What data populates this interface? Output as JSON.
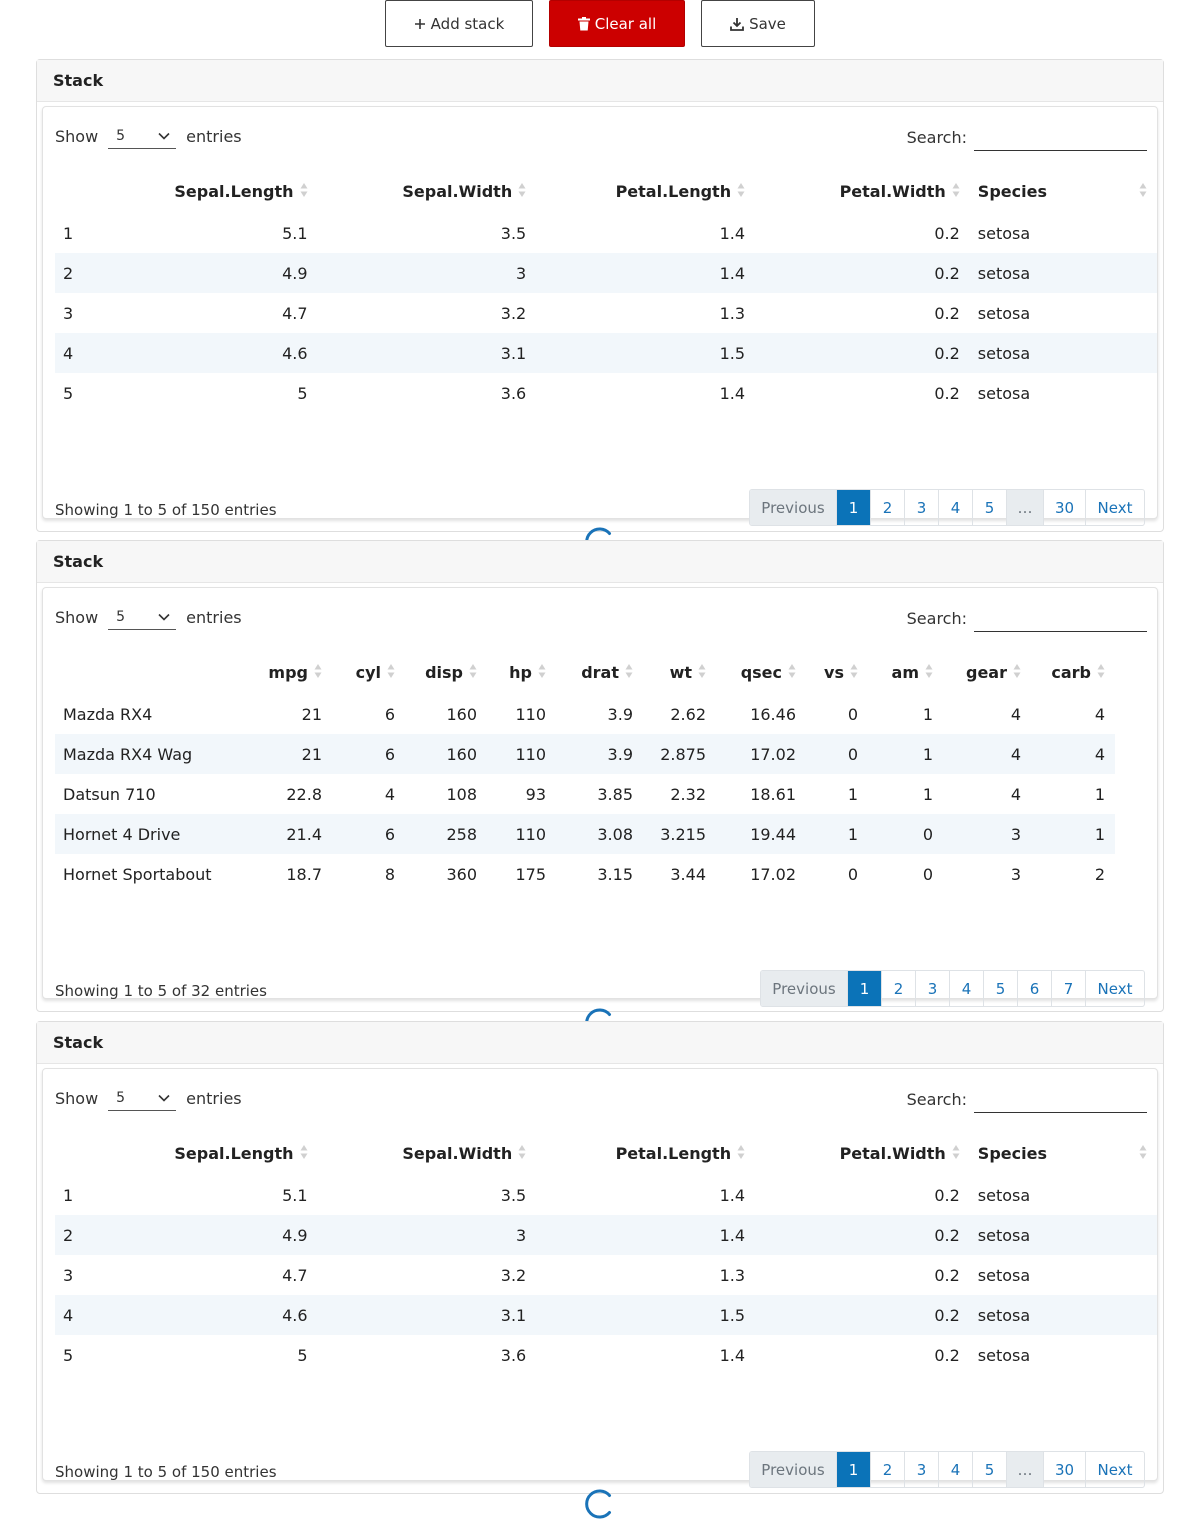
{
  "toolbar": {
    "add_label": "Add stack",
    "clear_label": "Clear all",
    "save_label": "Save",
    "danger_color": "#cc0000"
  },
  "stacks": [
    {
      "title": "Stack",
      "length_prefix": "Show",
      "length_value": "5",
      "length_suffix": "entries",
      "search_label": "Search:",
      "columns": [
        "",
        "Sepal.Length",
        "Sepal.Width",
        "Petal.Length",
        "Petal.Width",
        "Species"
      ],
      "rows": [
        [
          "1",
          "5.1",
          "3.5",
          "1.4",
          "0.2",
          "setosa"
        ],
        [
          "2",
          "4.9",
          "3",
          "1.4",
          "0.2",
          "setosa"
        ],
        [
          "3",
          "4.7",
          "3.2",
          "1.3",
          "0.2",
          "setosa"
        ],
        [
          "4",
          "4.6",
          "3.1",
          "1.5",
          "0.2",
          "setosa"
        ],
        [
          "5",
          "5",
          "3.6",
          "1.4",
          "0.2",
          "setosa"
        ]
      ],
      "info": "Showing 1 to 5 of 150 entries",
      "pagination": [
        "Previous",
        "1",
        "2",
        "3",
        "4",
        "5",
        "…",
        "30",
        "Next"
      ],
      "active_page": "1"
    },
    {
      "title": "Stack",
      "length_prefix": "Show",
      "length_value": "5",
      "length_suffix": "entries",
      "search_label": "Search:",
      "columns": [
        "",
        "mpg",
        "cyl",
        "disp",
        "hp",
        "drat",
        "wt",
        "qsec",
        "vs",
        "am",
        "gear",
        "carb"
      ],
      "rows": [
        [
          "Mazda RX4",
          "21",
          "6",
          "160",
          "110",
          "3.9",
          "2.62",
          "16.46",
          "0",
          "1",
          "4",
          "4"
        ],
        [
          "Mazda RX4 Wag",
          "21",
          "6",
          "160",
          "110",
          "3.9",
          "2.875",
          "17.02",
          "0",
          "1",
          "4",
          "4"
        ],
        [
          "Datsun 710",
          "22.8",
          "4",
          "108",
          "93",
          "3.85",
          "2.32",
          "18.61",
          "1",
          "1",
          "4",
          "1"
        ],
        [
          "Hornet 4 Drive",
          "21.4",
          "6",
          "258",
          "110",
          "3.08",
          "3.215",
          "19.44",
          "1",
          "0",
          "3",
          "1"
        ],
        [
          "Hornet Sportabout",
          "18.7",
          "8",
          "360",
          "175",
          "3.15",
          "3.44",
          "17.02",
          "0",
          "0",
          "3",
          "2"
        ]
      ],
      "info": "Showing 1 to 5 of 32 entries",
      "pagination": [
        "Previous",
        "1",
        "2",
        "3",
        "4",
        "5",
        "6",
        "7",
        "Next"
      ],
      "active_page": "1"
    },
    {
      "title": "Stack",
      "length_prefix": "Show",
      "length_value": "5",
      "length_suffix": "entries",
      "search_label": "Search:",
      "columns": [
        "",
        "Sepal.Length",
        "Sepal.Width",
        "Petal.Length",
        "Petal.Width",
        "Species"
      ],
      "rows": [
        [
          "1",
          "5.1",
          "3.5",
          "1.4",
          "0.2",
          "setosa"
        ],
        [
          "2",
          "4.9",
          "3",
          "1.4",
          "0.2",
          "setosa"
        ],
        [
          "3",
          "4.7",
          "3.2",
          "1.3",
          "0.2",
          "setosa"
        ],
        [
          "4",
          "4.6",
          "3.1",
          "1.5",
          "0.2",
          "setosa"
        ],
        [
          "5",
          "5",
          "3.6",
          "1.4",
          "0.2",
          "setosa"
        ]
      ],
      "info": "Showing 1 to 5 of 150 entries",
      "pagination": [
        "Previous",
        "1",
        "2",
        "3",
        "4",
        "5",
        "…",
        "30",
        "Next"
      ],
      "active_page": "1"
    }
  ]
}
